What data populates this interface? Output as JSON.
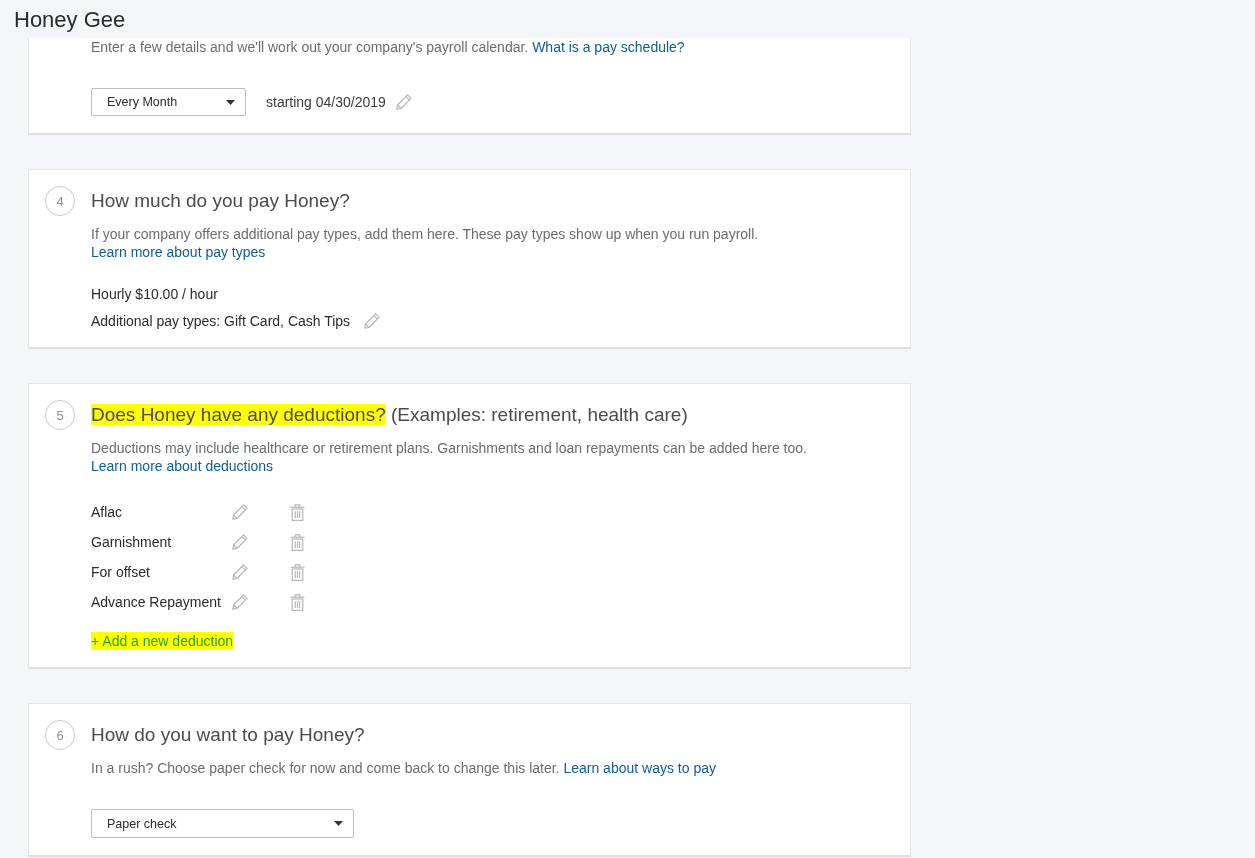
{
  "header": {
    "title": "Honey Gee"
  },
  "sections": [
    {
      "kind": "schedule",
      "description": "Enter a few details and we'll work out your company's payroll calendar.",
      "link": "What is a pay schedule?",
      "dropdown": {
        "value": "Every Month"
      },
      "start_date": "starting 04/30/2019"
    },
    {
      "kind": "pay",
      "step": "4",
      "title": [
        {
          "text": "How much do you pay Honey?",
          "highlighted": false
        }
      ],
      "description": "If your company offers additional pay types, add them here. These pay types show up when you run payroll.",
      "link": "Learn more about pay types",
      "lines": [
        {
          "text": "Hourly $10.00 / hour",
          "editable": false
        },
        {
          "text": "Additional pay types: Gift Card, Cash Tips",
          "editable": true
        }
      ]
    },
    {
      "kind": "deductions",
      "step": "5",
      "title": [
        {
          "text": "Does Honey have any deductions?",
          "highlighted": true
        },
        {
          "text": "(Examples: retirement, health care)",
          "highlighted": false
        }
      ],
      "description": "Deductions may include healthcare or retirement plans. Garnishments and loan repayments can be added here too.",
      "link": "Learn more about deductions",
      "deductions": [
        {
          "name": "Aflac"
        },
        {
          "name": "Garnishment"
        },
        {
          "name": "For offset"
        },
        {
          "name": "Advance Repayment"
        }
      ],
      "add_link": {
        "text": "+ Add a new deduction",
        "highlighted": true
      }
    },
    {
      "kind": "payment",
      "step": "6",
      "title": [
        {
          "text": "How do you want to pay Honey?",
          "highlighted": false
        }
      ],
      "description": "In a rush? Choose paper check for now and come back to change this later.",
      "link": "Learn about ways to pay",
      "dropdown": {
        "value": "Paper check"
      }
    }
  ]
}
